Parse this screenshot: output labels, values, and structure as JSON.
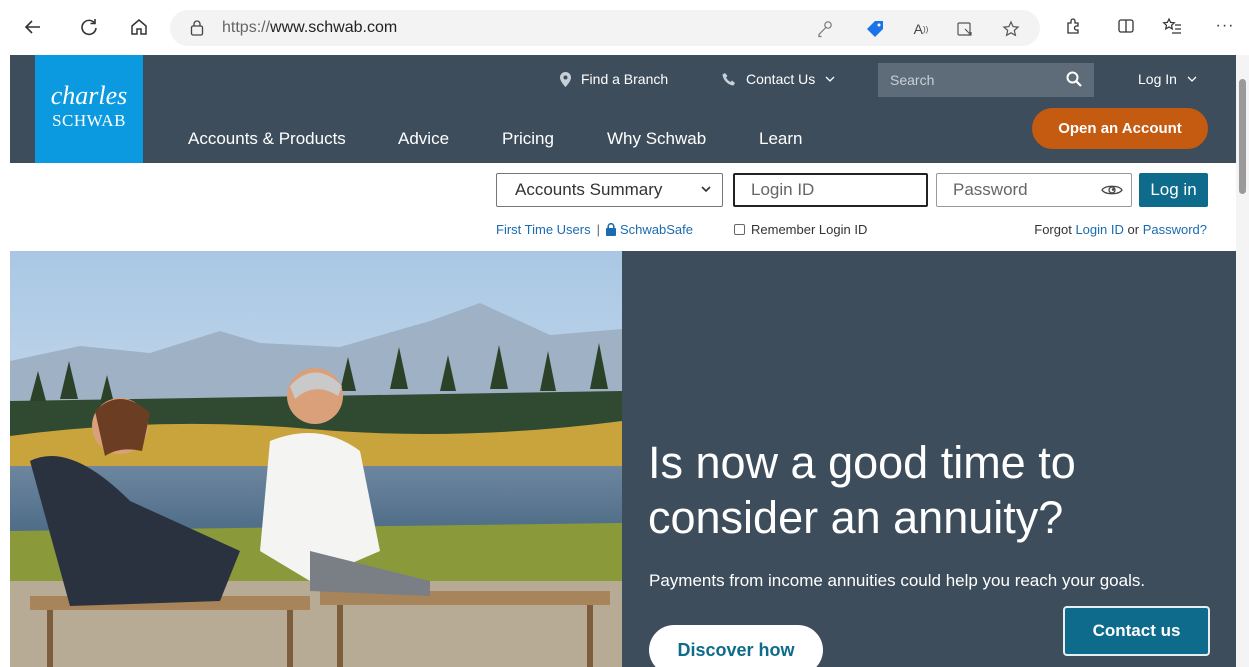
{
  "browser": {
    "url_scheme": "https://",
    "url_host": "www.schwab.com"
  },
  "logo": {
    "line1": "charles",
    "line2": "SCHWAB"
  },
  "utility_nav": {
    "find_branch": "Find a Branch",
    "contact_us": "Contact Us",
    "search_placeholder": "Search",
    "log_in": "Log In"
  },
  "main_nav": [
    "Accounts & Products",
    "Advice",
    "Pricing",
    "Why Schwab",
    "Learn"
  ],
  "open_account": "Open an Account",
  "login": {
    "account_select": "Accounts Summary",
    "login_id_placeholder": "Login ID",
    "password_placeholder": "Password",
    "login_button": "Log in",
    "first_time_users": "First Time Users",
    "separator": "|",
    "schwab_safe": "SchwabSafe",
    "remember": "Remember Login ID",
    "forgot_prefix": "Forgot",
    "forgot_login_id": "Login ID",
    "forgot_or": "or",
    "forgot_password": "Password?"
  },
  "hero": {
    "title": "Is now a good time to consider an annuity?",
    "subtitle": "Payments from income annuities could help you reach your goals.",
    "cta": "Discover how"
  },
  "contact_us_button": "Contact us",
  "colors": {
    "header_bg": "#3e4d5b",
    "logo_bg": "#0b9ae0",
    "open_account_bg": "#c55a11",
    "primary_blue": "#0f6b8c",
    "link_blue": "#1a6bb0"
  }
}
